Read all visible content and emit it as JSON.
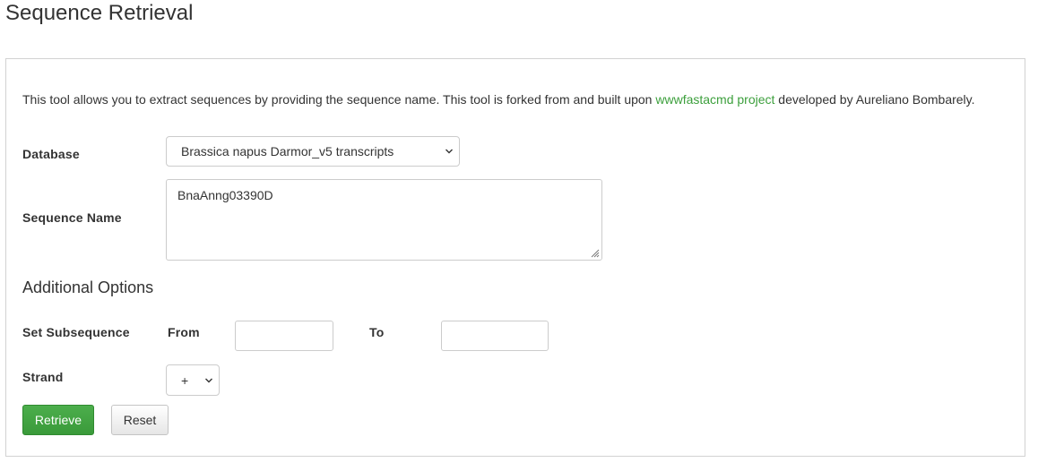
{
  "page": {
    "title": "Sequence Retrieval"
  },
  "intro": {
    "text_before": "This tool allows you to extract sequences by providing the sequence name. This tool is forked from and built upon ",
    "link_text": "wwwfastacmd project",
    "text_after": " developed by Aureliano Bombarely."
  },
  "form": {
    "database_label": "Database",
    "database_selected": "Brassica napus Darmor_v5 transcripts",
    "sequence_name_label": "Sequence Name",
    "sequence_name_value": "BnaAnng03390D",
    "additional_options_heading": "Additional Options",
    "subsequence_label": "Set Subsequence",
    "from_label": "From",
    "from_value": "",
    "to_label": "To",
    "to_value": "",
    "strand_label": "Strand",
    "strand_selected": "+",
    "retrieve_label": "Retrieve",
    "reset_label": "Reset"
  },
  "colors": {
    "link": "#3c9f3c",
    "primary_button": "#449d44",
    "border": "#cccccc"
  },
  "icons": {
    "select_arrow": "chevron-down-icon",
    "textarea_resize": "resize-grip-icon"
  }
}
